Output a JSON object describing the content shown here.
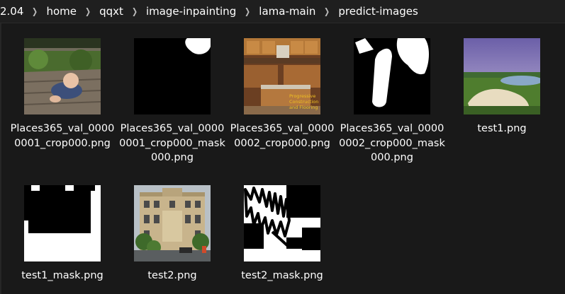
{
  "breadcrumb": {
    "items": [
      "2.04",
      "home",
      "qqxt",
      "image-inpainting",
      "lama-main",
      "predict-images"
    ],
    "separator_icon": "chevron-right-icon"
  },
  "files": [
    {
      "name": "Places365_val_00000001_crop000.png",
      "thumb": "photo-baby-on-deck"
    },
    {
      "name": "Places365_val_00000001_crop000_mask000.png",
      "thumb": "mask-black-with-white-corner"
    },
    {
      "name": "Places365_val_00000002_crop000.png",
      "thumb": "photo-kitchen"
    },
    {
      "name": "Places365_val_00000002_crop000_mask000.png",
      "thumb": "mask-white-strokes"
    },
    {
      "name": "test1.png",
      "thumb": "photo-golf-course"
    },
    {
      "name": "test1_mask.png",
      "thumb": "mask-black-block"
    },
    {
      "name": "test2.png",
      "thumb": "photo-building"
    },
    {
      "name": "test2_mask.png",
      "thumb": "mask-scribbles"
    }
  ],
  "thumbnail_text": {
    "kitchen_watermark": [
      "Progressive",
      "Construction",
      "and Flooring"
    ]
  },
  "colors": {
    "background": "#191919",
    "text": "#ffffff",
    "separator": "#bdbdbd"
  }
}
